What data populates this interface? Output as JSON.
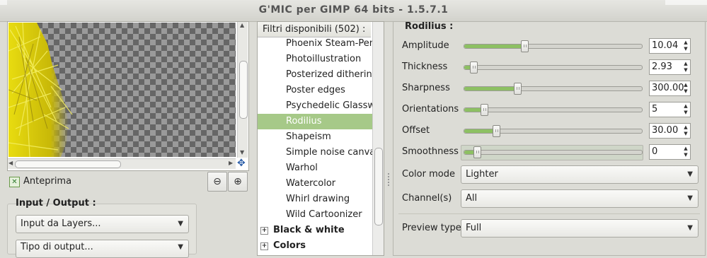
{
  "window": {
    "title": "G'MIC per GIMP 64 bits - 1.5.7.1"
  },
  "preview": {
    "checkbox_label": "Anteprima",
    "checked": true
  },
  "io": {
    "group_title": "Input / Output :",
    "input_value": "Input da Layers...",
    "output_value": "Tipo di output..."
  },
  "filters": {
    "header": "Filtri disponibili (502) :",
    "items": [
      "Phoenix Steam-Pencil",
      "Photoillustration",
      "Posterized dithering",
      "Poster edges",
      "Psychedelic Glasswork",
      "Rodilius",
      "Shapeism",
      "Simple noise canvas",
      "Warhol",
      "Watercolor",
      "Whirl drawing",
      "Wild Cartoonizer"
    ],
    "selected": "Rodilius",
    "categories": [
      {
        "label": "Black & white",
        "expander": "+"
      },
      {
        "label": "Colors",
        "expander": "+"
      }
    ]
  },
  "params": {
    "title": "Rodilius :",
    "sliders": [
      {
        "label": "Amplitude",
        "value": "10.04",
        "fraction": 0.34
      },
      {
        "label": "Thickness",
        "value": "2.93",
        "fraction": 0.05
      },
      {
        "label": "Sharpness",
        "value": "300.00",
        "fraction": 0.3
      },
      {
        "label": "Orientations",
        "value": "5",
        "fraction": 0.11
      },
      {
        "label": "Offset",
        "value": "30.00",
        "fraction": 0.18
      },
      {
        "label": "Smoothness",
        "value": "0",
        "fraction": 0.07
      }
    ],
    "color_mode": {
      "label": "Color mode",
      "value": "Lighter"
    },
    "channels": {
      "label": "Channel(s)",
      "value": "All"
    },
    "preview_type": {
      "label": "Preview type",
      "value": "Full"
    }
  },
  "colors": {
    "accent_green": "#8dc063",
    "selected_row": "#a6c988",
    "preview_yellow": "#e8dc10"
  },
  "icons": [
    "zoom-out-icon",
    "zoom-in-icon",
    "move-icon",
    "checkbox-icon",
    "dropdown-arrow-icon",
    "spin-arrows-icon"
  ]
}
